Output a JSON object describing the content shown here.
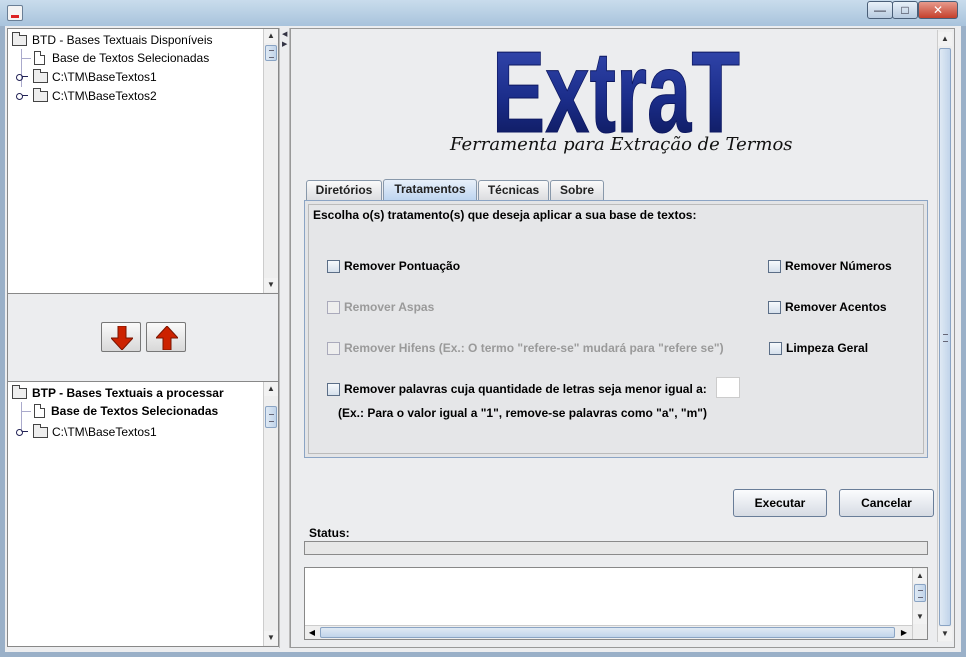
{
  "window": {
    "minimize_glyph": "—",
    "maximize_glyph": "□",
    "close_glyph": "✕"
  },
  "tree_top": {
    "root_label": "BTD - Bases Textuais Disponíveis",
    "items": [
      {
        "label": "Base de Textos Selecionadas",
        "icon": "document-icon"
      },
      {
        "label": "C:\\TM\\BaseTextos1",
        "icon": "folder-icon"
      },
      {
        "label": "C:\\TM\\BaseTextos2",
        "icon": "folder-icon"
      }
    ]
  },
  "tree_bottom": {
    "root_label": "BTP - Bases Textuais a processar",
    "items": [
      {
        "label": "Base de Textos Selecionadas",
        "icon": "document-icon"
      },
      {
        "label": "C:\\TM\\BaseTextos1",
        "icon": "folder-icon"
      }
    ]
  },
  "transfer": {
    "down_icon": "arrow-down-icon",
    "up_icon": "arrow-up-icon",
    "down_color": "#cc2200",
    "up_color": "#cc2200"
  },
  "header": {
    "logo_text": "ExtraT",
    "logo_color": "#1b2d8a",
    "subtitle": "Ferramenta para Extração de Termos"
  },
  "tabs": [
    {
      "label": "Diretórios",
      "active": false
    },
    {
      "label": "Tratamentos",
      "active": true
    },
    {
      "label": "Técnicas",
      "active": false
    },
    {
      "label": "Sobre",
      "active": false
    }
  ],
  "tratamentos": {
    "prompt": "Escolha o(s) tratamento(s) que deseja aplicar a sua base de textos:",
    "options": {
      "remover_pontuacao": {
        "label": "Remover Pontuação",
        "checked": false,
        "enabled": true
      },
      "remover_numeros": {
        "label": "Remover Números",
        "checked": false,
        "enabled": true
      },
      "remover_aspas": {
        "label": "Remover Aspas",
        "checked": false,
        "enabled": false
      },
      "remover_acentos": {
        "label": "Remover Acentos",
        "checked": false,
        "enabled": true
      },
      "remover_hifens": {
        "label": "Remover Hifens  (Ex.: O termo \"refere-se\" mudará para \"refere se\")",
        "checked": false,
        "enabled": false
      },
      "limpeza_geral": {
        "label": "Limpeza Geral",
        "checked": false,
        "enabled": true
      },
      "remover_palavras": {
        "label": "Remover palavras cuja quantidade de letras seja menor igual a:",
        "checked": false,
        "enabled": true
      }
    },
    "min_letters_value": "",
    "example_note": "(Ex.: Para o valor igual a \"1\", remove-se palavras como \"a\", \"m\")"
  },
  "actions": {
    "execute_label": "Executar",
    "cancel_label": "Cancelar"
  },
  "status": {
    "label": "Status:",
    "progress": 0,
    "log_text": ""
  }
}
